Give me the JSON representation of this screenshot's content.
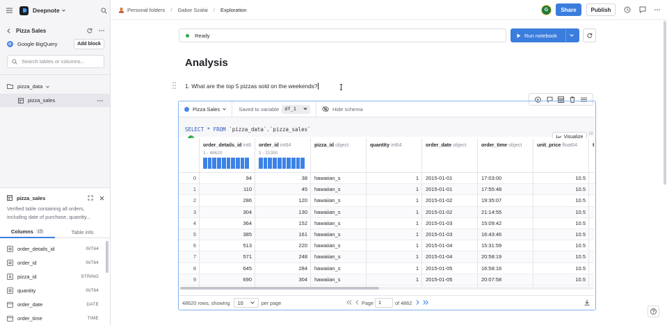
{
  "app": {
    "name": "Deepnote"
  },
  "sidebar": {
    "project_title": "Pizza Sales",
    "integration": "Google BigQuery",
    "add_block_label": "Add block",
    "search_placeholder": "Search tables or columns...",
    "tree": {
      "dataset": "pizza_data",
      "table": "pizza_sales"
    },
    "schema_panel": {
      "title": "pizza_sales",
      "description": "Verified table containing all orders, including date of purchase, quantity...",
      "tabs": [
        {
          "label": "Columns",
          "count": "15"
        },
        {
          "label": "Table info"
        }
      ],
      "columns": [
        {
          "name": "order_details_id",
          "type": "INT64",
          "icon": "hash-icon"
        },
        {
          "name": "order_id",
          "type": "INT64",
          "icon": "hash-icon"
        },
        {
          "name": "pizza_id",
          "type": "STRING",
          "icon": "text-type-icon"
        },
        {
          "name": "quantity",
          "type": "INT64",
          "icon": "hash-icon"
        },
        {
          "name": "order_date",
          "type": "DATE",
          "icon": "calendar-icon"
        },
        {
          "name": "order_time",
          "type": "TIME",
          "icon": "calendar-icon"
        }
      ]
    }
  },
  "header": {
    "breadcrumbs": [
      "Personal folders",
      "Gabor Szalai",
      "Exploration"
    ],
    "avatar_initial": "G",
    "share_label": "Share",
    "publish_label": "Publish"
  },
  "toolbar": {
    "status": "Ready",
    "run_label": "Run notebook"
  },
  "notebook": {
    "title": "Analysis",
    "text_block": "1. What are the top 5 pizzas sold on the weekends?"
  },
  "sql_block": {
    "source": "Pizza Sales",
    "saved_label": "Saved to variable",
    "variable": "df_1",
    "hide_schema": "Hide schema",
    "query": {
      "kw_select": "SELECT",
      "star": "*",
      "kw_from": "FROM",
      "table": "`pizza_data`.`pizza_sales`"
    },
    "visualize_label": "Visualize",
    "line_number": "16",
    "columns": [
      {
        "name": "order_details_id",
        "type": "int64",
        "range": "1 - 48620"
      },
      {
        "name": "order_id",
        "type": "int64",
        "range": "1 - 21350"
      },
      {
        "name": "pizza_id",
        "type": "object"
      },
      {
        "name": "quantity",
        "type": "int64"
      },
      {
        "name": "order_date",
        "type": "object"
      },
      {
        "name": "order_time",
        "type": "object"
      },
      {
        "name": "unit_price",
        "type": "float64"
      },
      {
        "name": "t"
      }
    ],
    "rows": [
      [
        "0",
        "94",
        "38",
        "hawaiian_s",
        "1",
        "2015-01-01",
        "17:03:00",
        "10.5"
      ],
      [
        "1",
        "110",
        "45",
        "hawaiian_s",
        "1",
        "2015-01-01",
        "17:55:48",
        "10.5"
      ],
      [
        "2",
        "286",
        "120",
        "hawaiian_s",
        "1",
        "2015-01-02",
        "19:35:07",
        "10.5"
      ],
      [
        "3",
        "304",
        "130",
        "hawaiian_s",
        "1",
        "2015-01-02",
        "21:14:55",
        "10.5"
      ],
      [
        "4",
        "364",
        "152",
        "hawaiian_s",
        "1",
        "2015-01-03",
        "15:09:42",
        "10.5"
      ],
      [
        "5",
        "385",
        "161",
        "hawaiian_s",
        "1",
        "2015-01-03",
        "16:43:46",
        "10.5"
      ],
      [
        "6",
        "513",
        "220",
        "hawaiian_s",
        "1",
        "2015-01-04",
        "15:31:59",
        "10.5"
      ],
      [
        "7",
        "571",
        "248",
        "hawaiian_s",
        "1",
        "2015-01-04",
        "20:58:19",
        "10.5"
      ],
      [
        "8",
        "645",
        "284",
        "hawaiian_s",
        "1",
        "2015-01-05",
        "16:58:16",
        "10.5"
      ],
      [
        "9",
        "690",
        "304",
        "hawaiian_s",
        "1",
        "2015-01-05",
        "20:07:58",
        "10.5"
      ]
    ],
    "footer": {
      "rows_text": "48620 rows, showing",
      "page_size": "10",
      "per_page": "per page",
      "page_label": "Page",
      "page_value": "1",
      "of_pages": "of 4862"
    }
  },
  "colors": {
    "accent": "#3b7ddd",
    "ready_dot": "#2fa84f",
    "histogram": "#3b82e6",
    "block_border": "#7fb2f0"
  },
  "help_icon": "help-icon"
}
